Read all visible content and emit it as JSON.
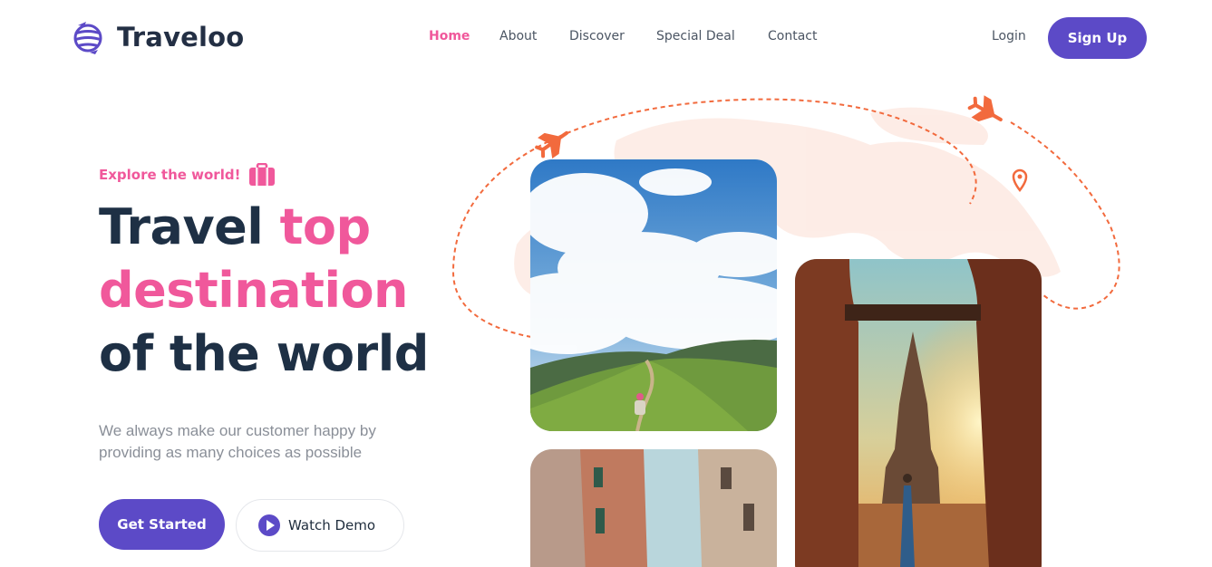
{
  "brand": {
    "name": "Traveloo"
  },
  "nav": {
    "items": [
      {
        "label": "Home",
        "active": true
      },
      {
        "label": "About"
      },
      {
        "label": "Discover"
      },
      {
        "label": "Special Deal"
      },
      {
        "label": "Contact"
      }
    ],
    "login": "Login",
    "signup": "Sign Up"
  },
  "hero": {
    "kicker": "Explore the world!",
    "title_line1_a": "Travel ",
    "title_line1_b": "top",
    "title_line2": "destination",
    "title_line3": "of the world",
    "subtitle": "We always make our customer happy by providing as many choices as possible",
    "cta_primary": "Get Started",
    "cta_secondary": "Watch Demo"
  },
  "colors": {
    "accent": "#5c4ac7",
    "pink": "#f0589b",
    "heading": "#1e3045",
    "orange": "#f26a3d"
  },
  "icons": [
    "globe-logo-icon",
    "suitcase-icon",
    "play-icon",
    "airplane-icon",
    "location-pin-icon"
  ]
}
